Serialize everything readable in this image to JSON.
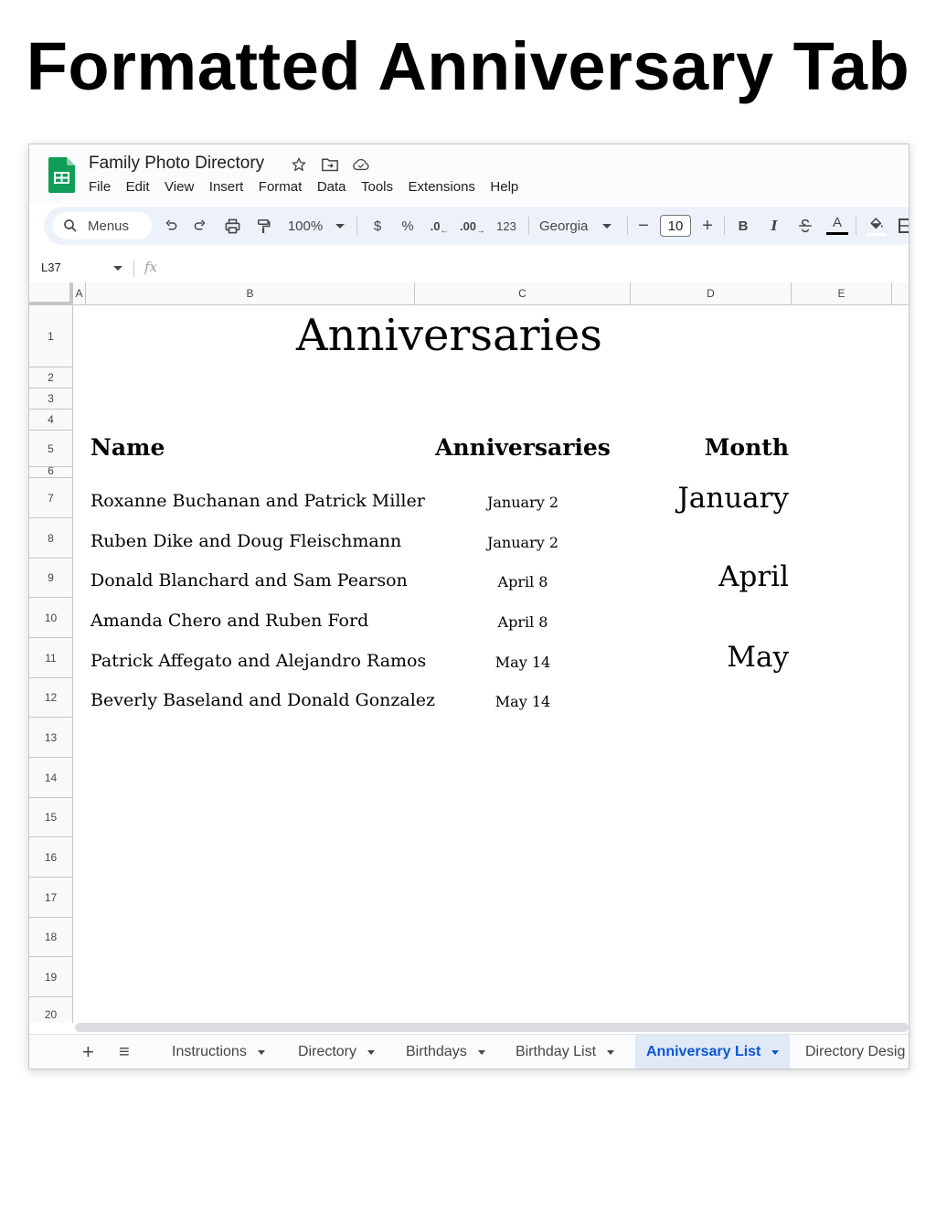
{
  "page_heading": "Formatted Anniversary Tab",
  "app": {
    "doc_title": "Family Photo Directory",
    "menu": [
      "File",
      "Edit",
      "View",
      "Insert",
      "Format",
      "Data",
      "Tools",
      "Extensions",
      "Help"
    ]
  },
  "toolbar": {
    "menus_label": "Menus",
    "zoom": "100%",
    "currency": "$",
    "percent": "%",
    "dec_decrease": ".0",
    "dec_increase": ".00",
    "number_format": "123",
    "font": "Georgia",
    "font_size": "10",
    "minus": "−",
    "plus": "+",
    "bold": "B",
    "italic": "I",
    "text_color_letter": "A"
  },
  "formula_bar": {
    "cell_ref": "L37",
    "fx": "fx"
  },
  "columns": [
    "A",
    "B",
    "C",
    "D",
    "E"
  ],
  "rows": [
    "1",
    "2",
    "3",
    "4",
    "5",
    "6",
    "7",
    "8",
    "9",
    "10",
    "11",
    "12",
    "13",
    "14",
    "15",
    "16",
    "17",
    "18",
    "19",
    "20"
  ],
  "sheet": {
    "title": "Anniversaries",
    "headers": {
      "name": "Name",
      "anniversaries": "Anniversaries",
      "month": "Month"
    },
    "entries": [
      {
        "name": "Roxanne Buchanan and Patrick Miller",
        "date": "January 2"
      },
      {
        "name": "Ruben Dike and Doug Fleischmann",
        "date": "January 2"
      },
      {
        "name": "Donald Blanchard and Sam Pearson",
        "date": "April 8"
      },
      {
        "name": "Amanda Chero and Ruben Ford",
        "date": "April 8"
      },
      {
        "name": "Patrick Affegato and Alejandro Ramos",
        "date": "May 14"
      },
      {
        "name": "Beverly Baseland and Donald Gonzalez",
        "date": "May 14"
      }
    ],
    "months": [
      "January",
      "April",
      "May"
    ]
  },
  "tabs": {
    "add": "+",
    "all_sheets": "≡",
    "items": [
      "Instructions",
      "Directory",
      "Birthdays",
      "Birthday List",
      "Anniversary List",
      "Directory Desig"
    ],
    "active": "Anniversary List"
  },
  "colors": {
    "accent": "#0b57d0",
    "sheets_green": "#0f9d58",
    "toolbar_bg": "#edf2fa",
    "active_tab_bg": "#e1e9f7"
  }
}
